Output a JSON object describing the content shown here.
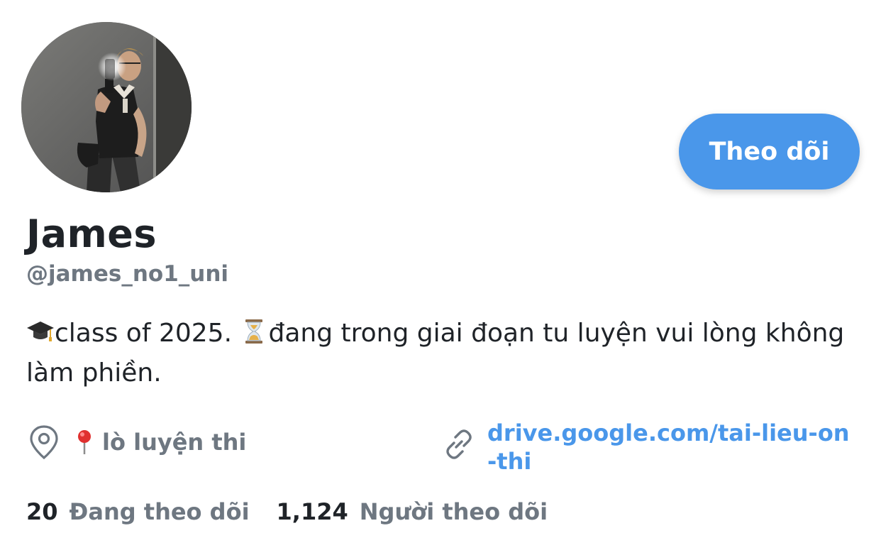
{
  "profile": {
    "display_name": "James",
    "handle": "@james_no1_uni",
    "bio_line_parts": [
      "class of 2025. ",
      "đang trong giai đoạn tu luyện vui lòng không làm phiền."
    ],
    "location": "lò luyện thi",
    "link": "drive.google.com/tai-lieu-on-thi"
  },
  "actions": {
    "follow_label": "Theo dõi"
  },
  "stats": {
    "following_count": "20",
    "following_label": "Đang theo dõi",
    "followers_count": "1,124",
    "followers_label": "Người theo dõi"
  },
  "icons": {
    "bio_1": "graduation-cap-emoji",
    "bio_2": "hourglass-emoji",
    "location": "map-pin-outline-icon",
    "location_emoji": "round-pushpin-emoji",
    "link": "link-chain-icon"
  },
  "colors": {
    "accent": "#4a97ea",
    "muted": "#6e7781",
    "text": "#1f2328"
  }
}
